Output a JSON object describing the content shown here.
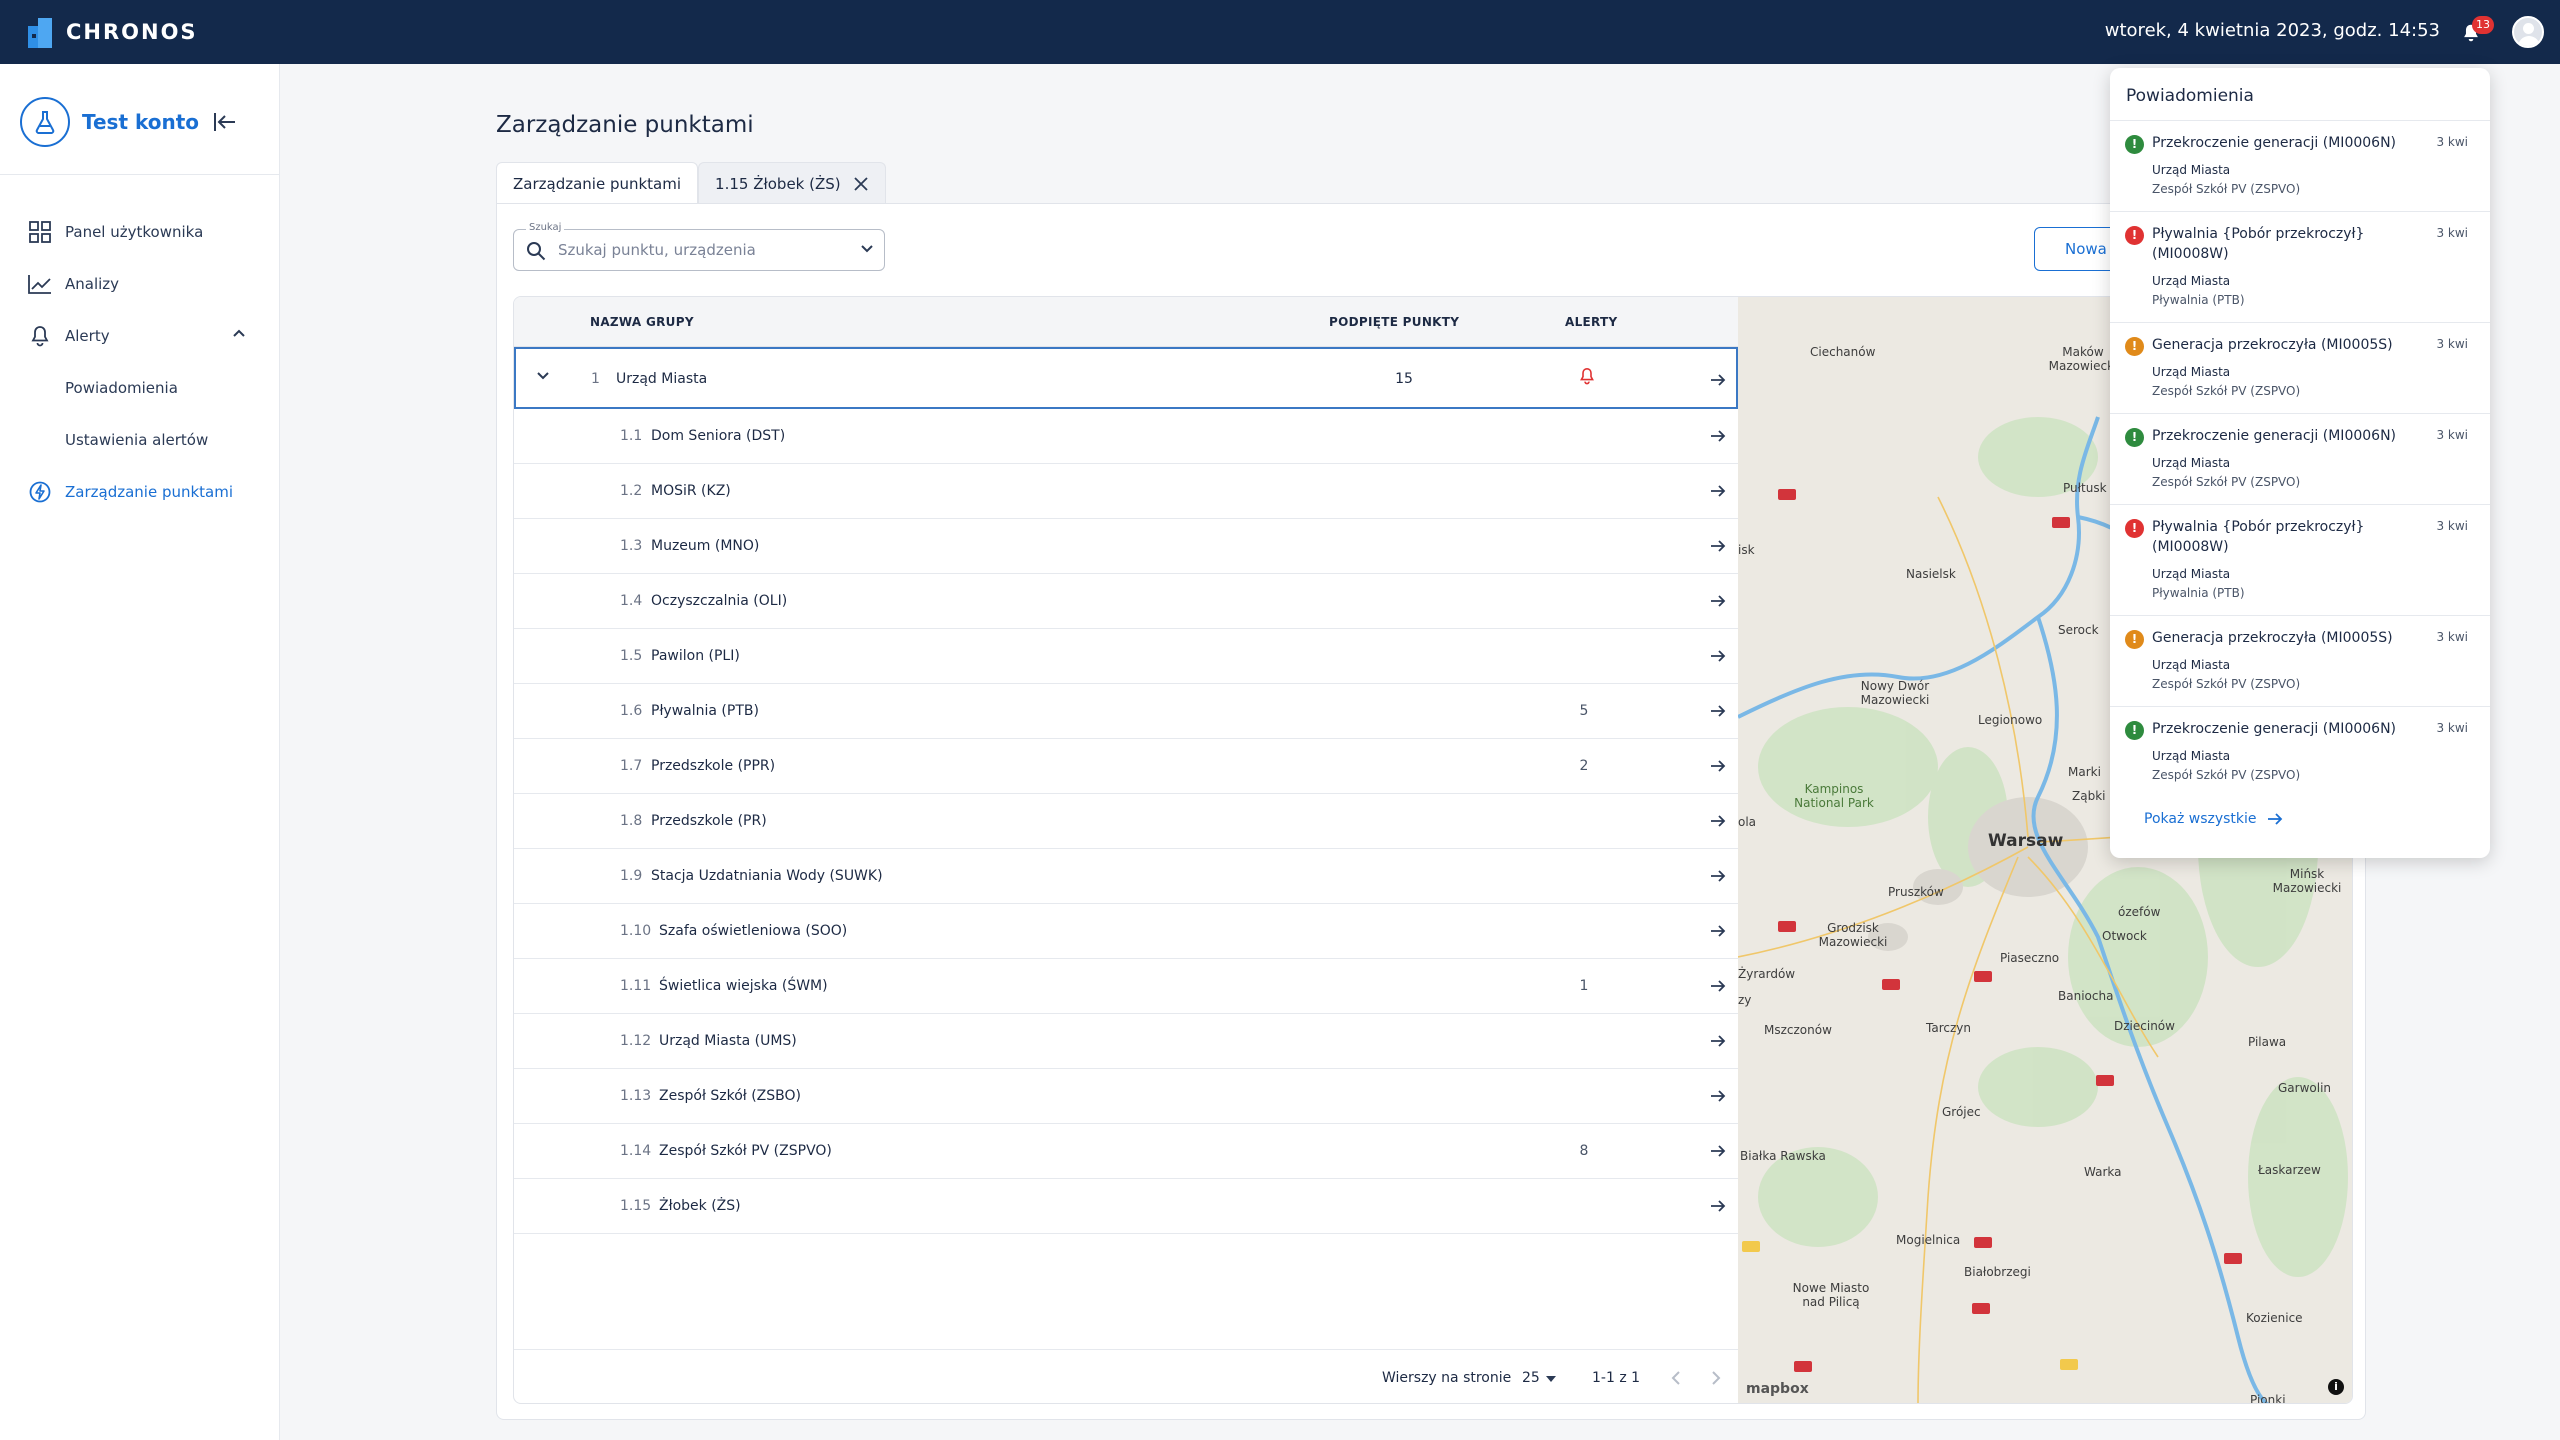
{
  "app": {
    "name": "CHRONOS"
  },
  "topbar": {
    "datetime": "wtorek, 4 kwietnia 2023, godz. 14:53",
    "notification_count": "13"
  },
  "sidebar": {
    "account_name": "Test konto",
    "items": [
      {
        "label": "Panel użytkownika"
      },
      {
        "label": "Analizy"
      },
      {
        "label": "Alerty"
      },
      {
        "label": "Powiadomienia"
      },
      {
        "label": "Ustawienia alertów"
      },
      {
        "label": "Zarządzanie punktami"
      }
    ]
  },
  "main": {
    "title": "Zarządzanie punktami",
    "tabs": [
      {
        "label": "Zarządzanie punktami"
      },
      {
        "label": "1.15 Żłobek (ŻS)"
      }
    ],
    "search": {
      "legend": "Szukaj",
      "placeholder": "Szukaj punktu, urządzenia",
      "value": ""
    },
    "new_button": "Nowa",
    "table": {
      "headers": {
        "name": "NAZWA GRUPY",
        "points": "PODPIĘTE PUNKTY",
        "alerts": "ALERTY"
      },
      "group": {
        "num": "1",
        "name": "Urząd Miasta",
        "points": "15"
      },
      "rows": [
        {
          "num": "1.1",
          "name": "Dom Seniora (DST)",
          "alerts": ""
        },
        {
          "num": "1.2",
          "name": "MOSiR (KZ)",
          "alerts": ""
        },
        {
          "num": "1.3",
          "name": "Muzeum (MNO)",
          "alerts": ""
        },
        {
          "num": "1.4",
          "name": "Oczyszczalnia (OLI)",
          "alerts": ""
        },
        {
          "num": "1.5",
          "name": "Pawilon (PLI)",
          "alerts": ""
        },
        {
          "num": "1.6",
          "name": "Pływalnia (PTB)",
          "alerts": "5"
        },
        {
          "num": "1.7",
          "name": "Przedszkole (PPR)",
          "alerts": "2"
        },
        {
          "num": "1.8",
          "name": "Przedszkole (PR)",
          "alerts": ""
        },
        {
          "num": "1.9",
          "name": "Stacja Uzdatniania Wody (SUWK)",
          "alerts": ""
        },
        {
          "num": "1.10",
          "name": "Szafa oświetleniowa (SOO)",
          "alerts": ""
        },
        {
          "num": "1.11",
          "name": "Świetlica wiejska (ŚWM)",
          "alerts": "1"
        },
        {
          "num": "1.12",
          "name": "Urząd Miasta (UMS)",
          "alerts": ""
        },
        {
          "num": "1.13",
          "name": "Zespół Szkół (ZSBO)",
          "alerts": ""
        },
        {
          "num": "1.14",
          "name": "Zespół Szkół PV (ZSPVO)",
          "alerts": "8"
        },
        {
          "num": "1.15",
          "name": "Żłobek (ŻS)",
          "alerts": ""
        }
      ],
      "footer": {
        "rows_per_page_label": "Wierszy na stronie",
        "rows_per_page": "25",
        "range": "1-1 z 1"
      }
    }
  },
  "map": {
    "labels": [
      "Ciechanów",
      "Maków Mazowiecki",
      "Pułtusk",
      "Nasielsk",
      "Serock",
      "Nowy Dwór Mazowiecki",
      "Legionowo",
      "Marki",
      "Ząbki",
      "Kampinos National Park",
      "Warsaw",
      "Pruszków",
      "Grodzisk Mazowiecki",
      "Żyrardów",
      "Piaseczno",
      "Otwock",
      "Mińsk Mazowiecki",
      "Mszczonów",
      "Tarczyn",
      "Baniocha",
      "Dziecinów",
      "Pilawa",
      "Garwolin",
      "Grójec",
      "Białka Rawska",
      "Warka",
      "Łaskarzew",
      "Mogielnica",
      "Białobrzegi",
      "Nowe Miasto nad Pilicą",
      "Kozienice",
      "Pionki",
      "ola",
      "isk",
      "zy",
      "ózefów"
    ],
    "attribution": "mapbox",
    "info": "i"
  },
  "notifications": {
    "title": "Powiadomienia",
    "show_all": "Pokaż wszystkie",
    "colors": {
      "ok": "#2e8b3e",
      "error": "#e03232",
      "warning": "#e08a1a"
    },
    "items": [
      {
        "level": "ok",
        "title": "Przekroczenie generacji (MI0006N)",
        "date": "3 kwi",
        "line1": "Urząd Miasta",
        "line2": "Zespół Szkół PV (ZSPVO)"
      },
      {
        "level": "error",
        "title": "Pływalnia {Pobór przekroczył} (MI0008W)",
        "date": "3 kwi",
        "line1": "Urząd Miasta",
        "line2": "Pływalnia (PTB)"
      },
      {
        "level": "warning",
        "title": "Generacja przekroczyła (MI0005S)",
        "date": "3 kwi",
        "line1": "Urząd Miasta",
        "line2": "Zespół Szkół PV (ZSPVO)"
      },
      {
        "level": "ok",
        "title": "Przekroczenie generacji (MI0006N)",
        "date": "3 kwi",
        "line1": "Urząd Miasta",
        "line2": "Zespół Szkół PV (ZSPVO)"
      },
      {
        "level": "error",
        "title": "Pływalnia {Pobór przekroczył} (MI0008W)",
        "date": "3 kwi",
        "line1": "Urząd Miasta",
        "line2": "Pływalnia (PTB)"
      },
      {
        "level": "warning",
        "title": "Generacja przekroczyła (MI0005S)",
        "date": "3 kwi",
        "line1": "Urząd Miasta",
        "line2": "Zespół Szkół PV (ZSPVO)"
      },
      {
        "level": "ok",
        "title": "Przekroczenie generacji (MI0006N)",
        "date": "3 kwi",
        "line1": "Urząd Miasta",
        "line2": "Zespół Szkół PV (ZSPVO)"
      }
    ]
  }
}
